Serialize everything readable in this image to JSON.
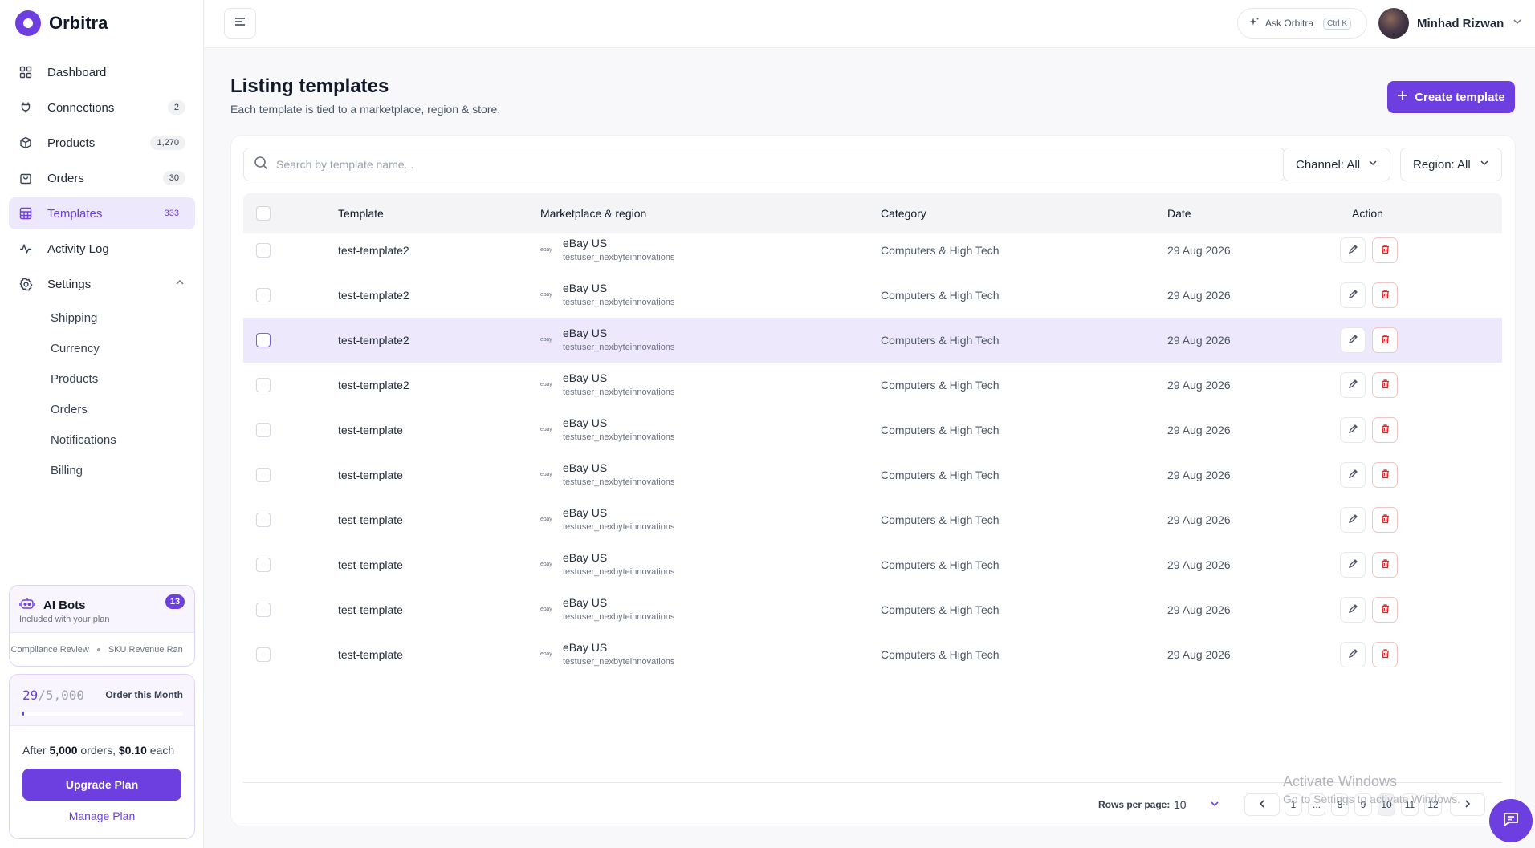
{
  "app": {
    "name": "Orbitra"
  },
  "sidebar": {
    "items": [
      {
        "label": "Dashboard",
        "count": ""
      },
      {
        "label": "Connections",
        "count": "2"
      },
      {
        "label": "Products",
        "count": "1,270"
      },
      {
        "label": "Orders",
        "count": "30"
      },
      {
        "label": "Templates",
        "count": "333"
      },
      {
        "label": "Activity Log",
        "count": ""
      },
      {
        "label": "Settings",
        "count": ""
      }
    ],
    "settings_sub": [
      "Shipping",
      "Currency",
      "Products",
      "Orders",
      "Notifications",
      "Billing"
    ],
    "bots": {
      "title": "AI Bots",
      "subtitle": "Included with your plan",
      "badge": "13",
      "ticker": [
        "ct Compliance Review",
        "SKU Revenue Ran"
      ]
    },
    "plan": {
      "used": "29",
      "limit": "/5,000",
      "label": "Order this Month",
      "usage_fraction": 0.0058,
      "after_prefix": "After ",
      "after_orders": "5,000",
      "after_mid": " orders, ",
      "after_price": "$0.10",
      "after_suffix": " each",
      "upgrade_label": "Upgrade Plan",
      "manage_label": "Manage Plan"
    }
  },
  "header": {
    "ask_label": "Ask Orbitra",
    "ask_shortcut": "Ctrl K",
    "user_name": "Minhad Rizwan"
  },
  "page": {
    "title": "Listing templates",
    "subtitle": "Each template is tied to a marketplace, region & store.",
    "create_label": "Create template"
  },
  "filters": {
    "search_placeholder": "Search by template name...",
    "channel": "Channel: All",
    "region": "Region: All"
  },
  "table": {
    "columns": [
      "Template",
      "Marketplace & region",
      "Category",
      "Date",
      "Action"
    ],
    "rows": [
      {
        "template": "test-template2",
        "logo": "ebay",
        "marketplace": "eBay US",
        "store": "testuser_nexbyteinnovations",
        "category": "Computers & High Tech",
        "date": "29 Aug 2026"
      },
      {
        "template": "test-template2",
        "logo": "ebay",
        "marketplace": "eBay US",
        "store": "testuser_nexbyteinnovations",
        "category": "Computers & High Tech",
        "date": "29 Aug 2026"
      },
      {
        "template": "test-template2",
        "logo": "ebay",
        "marketplace": "eBay US",
        "store": "testuser_nexbyteinnovations",
        "category": "Computers & High Tech",
        "date": "29 Aug 2026"
      },
      {
        "template": "test-template2",
        "logo": "ebay",
        "marketplace": "eBay US",
        "store": "testuser_nexbyteinnovations",
        "category": "Computers & High Tech",
        "date": "29 Aug 2026"
      },
      {
        "template": "test-template",
        "logo": "ebay",
        "marketplace": "eBay US",
        "store": "testuser_nexbyteinnovations",
        "category": "Computers & High Tech",
        "date": "29 Aug 2026"
      },
      {
        "template": "test-template",
        "logo": "ebay",
        "marketplace": "eBay US",
        "store": "testuser_nexbyteinnovations",
        "category": "Computers & High Tech",
        "date": "29 Aug 2026"
      },
      {
        "template": "test-template",
        "logo": "ebay",
        "marketplace": "eBay US",
        "store": "testuser_nexbyteinnovations",
        "category": "Computers & High Tech",
        "date": "29 Aug 2026"
      },
      {
        "template": "test-template",
        "logo": "ebay",
        "marketplace": "eBay US",
        "store": "testuser_nexbyteinnovations",
        "category": "Computers & High Tech",
        "date": "29 Aug 2026"
      },
      {
        "template": "test-template",
        "logo": "ebay",
        "marketplace": "eBay US",
        "store": "testuser_nexbyteinnovations",
        "category": "Computers & High Tech",
        "date": "29 Aug 2026"
      },
      {
        "template": "test-template",
        "logo": "ebay",
        "marketplace": "eBay US",
        "store": "testuser_nexbyteinnovations",
        "category": "Computers & High Tech",
        "date": "29 Aug 2026"
      }
    ]
  },
  "pagination": {
    "rows_label": "Rows per page:",
    "rows_value": "10",
    "pages": [
      "1",
      "...",
      "8",
      "9",
      "10",
      "11",
      "12"
    ],
    "current": "10"
  },
  "watermark": {
    "line1": "Activate Windows",
    "line2": "Go to Settings to activate Windows."
  },
  "colors": {
    "accent": "#6d3fe0",
    "danger": "#dc2626",
    "highlight_row": "#ede8fb"
  }
}
